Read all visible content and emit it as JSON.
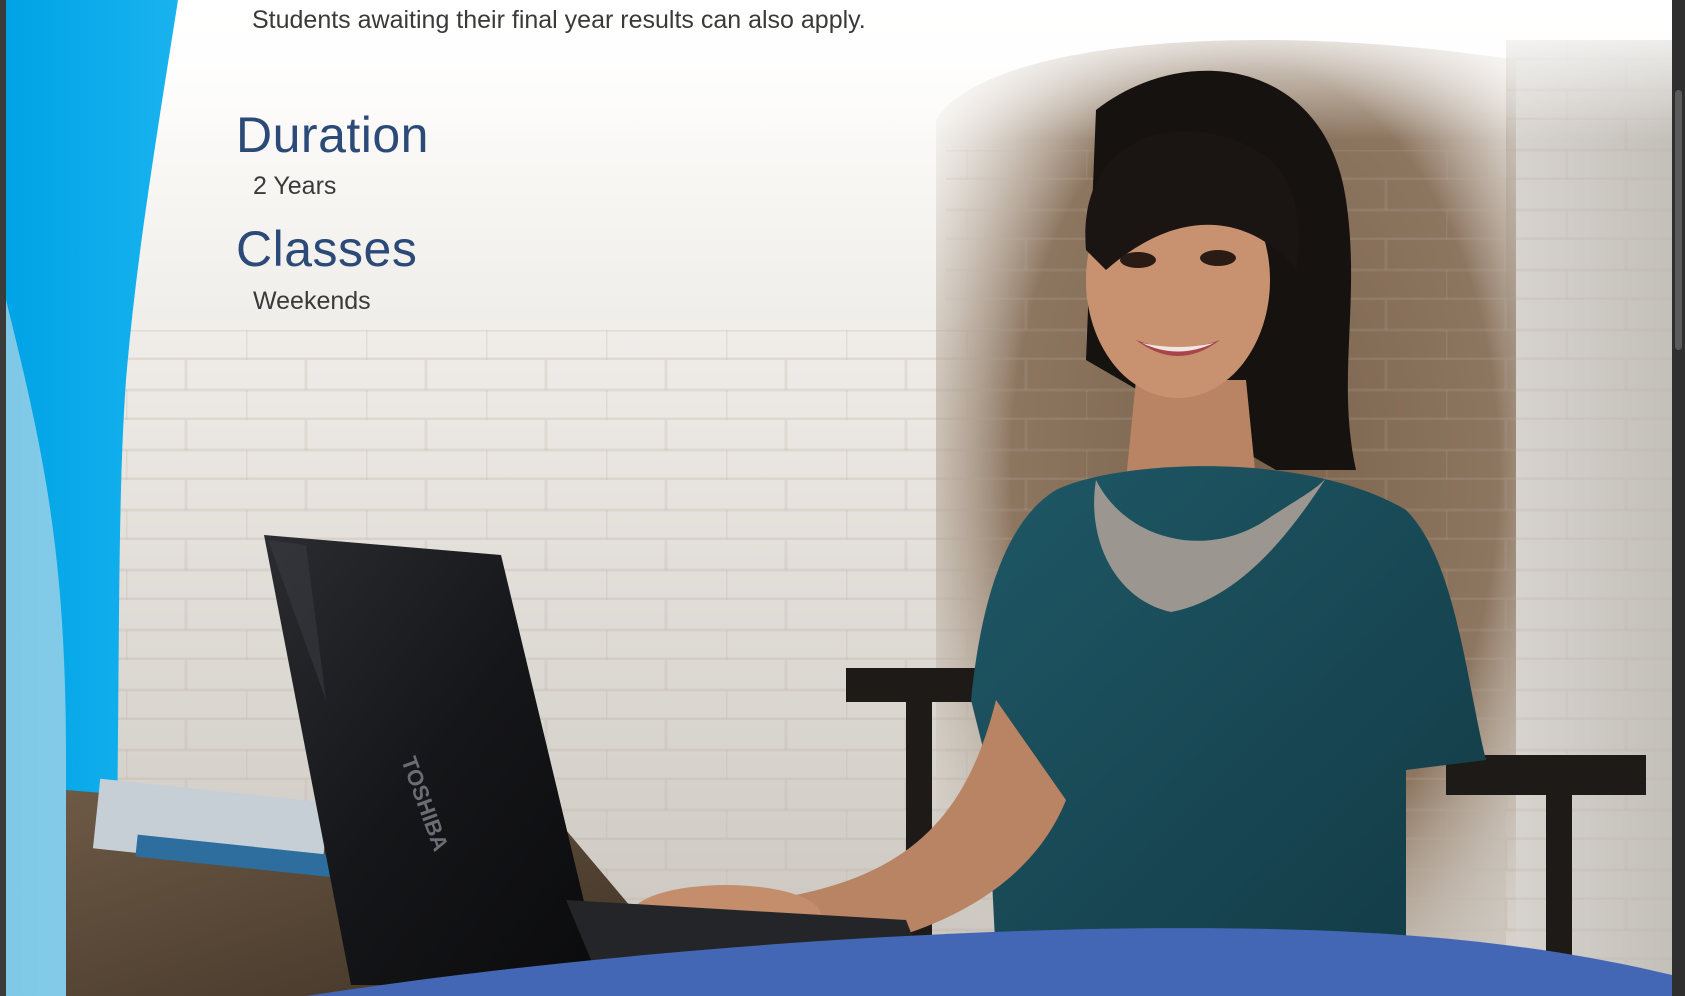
{
  "document": {
    "intro_line": "Students awaiting their final year results can also apply.",
    "sections": [
      {
        "heading": "Duration",
        "value": "2 Years"
      },
      {
        "heading": "Classes",
        "value": "Weekends"
      }
    ]
  },
  "photo": {
    "subject": "woman-with-laptop"
  },
  "colors": {
    "heading_blue": "#2c4a78",
    "body_text": "#3a3a3a",
    "left_accent_blue": "#00a6e8",
    "bottom_band_blue": "#4467b5"
  }
}
